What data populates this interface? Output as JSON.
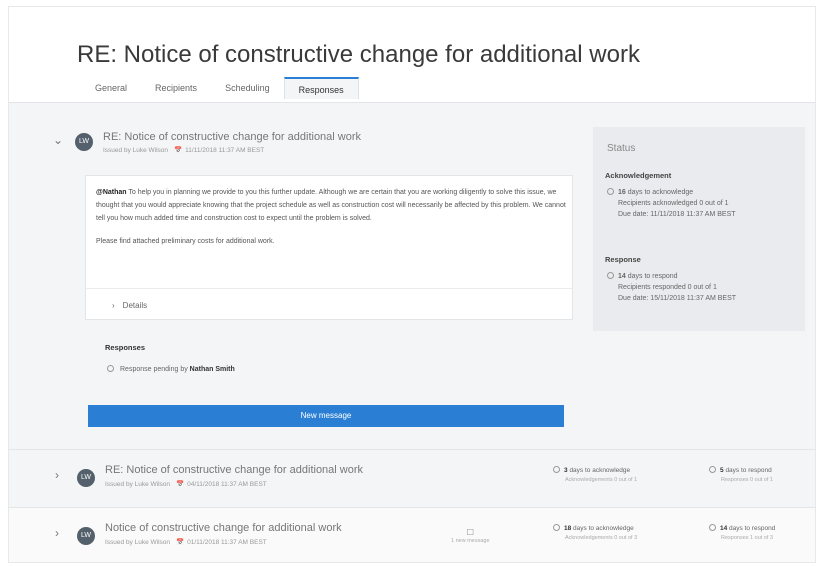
{
  "header": {
    "title": "RE: Notice of constructive change for additional work"
  },
  "tabs": [
    {
      "label": "General"
    },
    {
      "label": "Recipients"
    },
    {
      "label": "Scheduling"
    },
    {
      "label": "Responses"
    }
  ],
  "active_tab": "Responses",
  "expanded": {
    "avatar": "LW",
    "title": "RE: Notice of constructive change for additional work",
    "issued_by": "Issued by Luke Wilson",
    "date": "11/11/2018 11:37 AM BEST",
    "mention": "@Nathan",
    "body_p1": "To help you in planning we provide to you this further update. Although we are certain that you are working diligently to solve this issue, we thought that you would appreciate knowing that the project schedule as well as construction cost will necessarily be affected by this problem. We cannot tell you how much added time and construction cost to expect until the problem is solved.",
    "body_p2": "Please find attached preliminary costs for additional work.",
    "details_label": "Details",
    "responses_heading": "Responses",
    "response_pending_prefix": "Response pending by",
    "response_pending_name": "Nathan Smith",
    "new_message_label": "New message"
  },
  "status": {
    "heading": "Status",
    "acknowledgement": {
      "heading": "Acknowledgement",
      "days": "16",
      "days_label": "days to acknowledge",
      "recipients": "Recipients acknowledged 0 out of 1",
      "due": "Due date: 11/11/2018 11:37 AM BEST"
    },
    "response": {
      "heading": "Response",
      "days": "14",
      "days_label": "days to respond",
      "recipients": "Recipients responded 0 out of 1",
      "due": "Due date: 15/11/2018 11:37 AM BEST"
    }
  },
  "collapsed": [
    {
      "avatar": "LW",
      "title": "RE: Notice of constructive change for additional work",
      "issued_by": "Issued by Luke Wilson",
      "date": "04/11/2018 11:37 AM BEST",
      "ack_days": "3",
      "ack_label": "days to acknowledge",
      "ack_sub": "Acknowledgements 0 out of 1",
      "resp_days": "5",
      "resp_label": "days to respond",
      "resp_sub": "Responses 0 out of 1"
    },
    {
      "avatar": "LW",
      "title": "Notice of constructive change for additional work",
      "issued_by": "Issued by Luke Wilson",
      "date": "01/11/2018 11:37 AM BEST",
      "msg_count": "1 new message",
      "ack_days": "18",
      "ack_label": "days to acknowledge",
      "ack_sub": "Acknowledgements 0 out of 3",
      "resp_days": "14",
      "resp_label": "days to respond",
      "resp_sub": "Responses 1 out of 3"
    }
  ]
}
